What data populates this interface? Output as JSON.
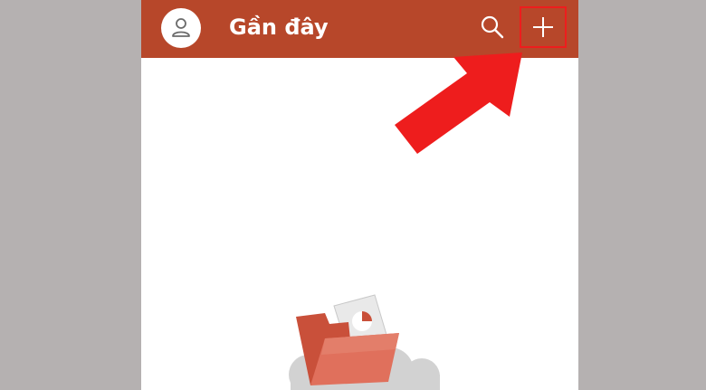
{
  "appbar": {
    "title": "Gần đây",
    "color": "#b7472a"
  },
  "icons": {
    "avatar": "user-avatar-icon",
    "search": "search-icon",
    "add": "plus-icon"
  },
  "annotation": {
    "arrow_color": "#ee1d1d",
    "highlight_color": "#ee1d1d"
  },
  "empty_state": {
    "illustration": "folder-with-document-on-clouds"
  }
}
